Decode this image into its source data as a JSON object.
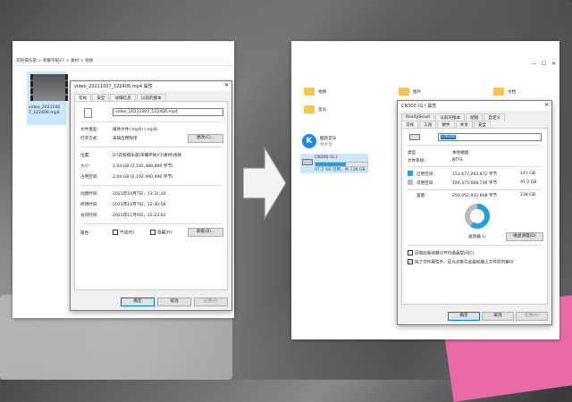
{
  "left_explorer": {
    "breadcrumb": [
      "花粉俱乐部",
      "荣耀平板V7",
      "素材",
      "视频"
    ],
    "file_name_line1": "video_2021100",
    "file_name_line2": "7_122406.mp4"
  },
  "props_dialog": {
    "title": "video_20211007_122406.mp4 属性",
    "tabs": [
      "常规",
      "安全",
      "详细信息",
      "以前的版本"
    ],
    "file_name": "video_20211007_122406.mp4",
    "file_type_label": "文件类型:",
    "file_type_value": "媒体文件(.mp4) (.mp4)",
    "open_with_label": "打开方式:",
    "open_with_value": "未知应用程序",
    "change_button": "更改(C)...",
    "location_label": "位置:",
    "location_value": "D:\\花粉俱乐部\\荣耀平板V7\\素材\\视频",
    "size_label": "大小:",
    "size_value": "2.04 GB (2,192,488,886 字节)",
    "disk_size_label": "占用空间:",
    "disk_size_value": "2.04 GB (2,192,490,496 字节)",
    "created_label": "创建时间:",
    "created_value": "2021年10月7日，13:31:20",
    "modified_label": "修改时间:",
    "modified_value": "2021年10月7日，12:40:58",
    "accessed_label": "访问时间:",
    "accessed_value": "2021年11月9日，22:23:02",
    "attributes_label": "属性:",
    "readonly_label": "只读(R)",
    "hidden_label": "隐藏(H)",
    "advanced_button": "高级(D)...",
    "ok_button": "确定",
    "cancel_button": "取消",
    "apply_button": "应用(A)"
  },
  "right_explorer": {
    "folders": [
      "视频",
      "图片",
      "文档",
      "音乐"
    ],
    "drive1_name": "酷狗音乐",
    "drive1_sub": "共享云",
    "drive2_name": "CN300 (G:)",
    "drive2_free": "97.2 GB 可用，共 238 GB",
    "drive2_fill_percent": 59
  },
  "drive_dialog": {
    "title": "CN300 (G:) 属性",
    "tabs_row1": [
      "ReadyBoost",
      "以前的版本",
      "配额",
      "自定义"
    ],
    "tabs_row2": [
      "常规",
      "工具",
      "硬件",
      "共享",
      "安全"
    ],
    "drive_name": "CN300",
    "type_label": "类型:",
    "type_value": "本地磁盘",
    "fs_label": "文件系统:",
    "fs_value": "NTFS",
    "used_label": "已用空间:",
    "used_bytes": "151,677,263,872 字节",
    "used_gb": "141 GB",
    "free_label": "可用空间:",
    "free_bytes": "104,375,668,736 字节",
    "free_gb": "97.2 GB",
    "capacity_label": "容量:",
    "capacity_bytes": "256,052,932,608 字节",
    "capacity_gb": "238 GB",
    "drive_label": "驱动器 G:",
    "cleanup_button": "磁盘清理(D)",
    "compress_label": "压缩此驱动器以节约磁盘空间(C)",
    "index_label": "除了文件属性外，还允许索引此驱动器上文件的内容(I)",
    "ok_button": "确定",
    "cancel_button": "取消",
    "apply_button": "应用(A)",
    "used_fraction": 0.59,
    "used_color": "#26a0da",
    "free_color": "#bcbcbc"
  }
}
